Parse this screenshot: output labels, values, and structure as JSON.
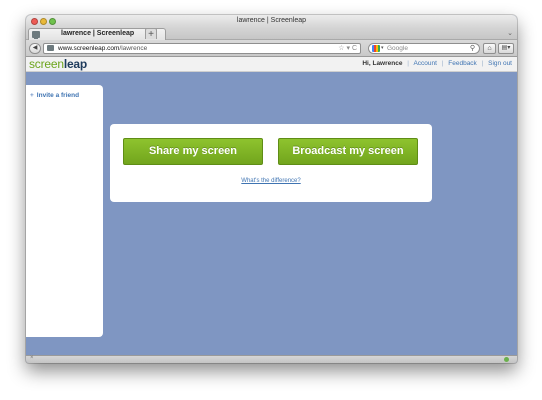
{
  "window": {
    "title": "lawrence | Screenleap"
  },
  "tabbar": {
    "tab_title": "lawrence | Screenleap",
    "close_glyph": "×",
    "new_tab_glyph": "+",
    "menu_glyph": "⌄"
  },
  "navbar": {
    "back_glyph": "◀",
    "url_host": "www.screenleap.com",
    "url_path": "/lawrence",
    "url_icons": "☆ ▾ C",
    "search_placeholder": "Google",
    "search_caret": "▾",
    "search_glyph": "⚲",
    "home_glyph": "⌂",
    "menu_glyph": "▤▾"
  },
  "header": {
    "logo_part1": "screen",
    "logo_part2": "leap",
    "greeting": "Hi, Lawrence",
    "separator": "|",
    "links": [
      "Account",
      "Feedback",
      "Sign out"
    ]
  },
  "sidebar": {
    "invite_plus": "+",
    "invite_label": "Invite a friend"
  },
  "card": {
    "share_label": "Share my screen",
    "broadcast_label": "Broadcast my screen",
    "difference_link": "What's the difference?"
  },
  "statusbar": {
    "close_glyph": "×"
  },
  "colors": {
    "background": "#7f96c2",
    "button_green": "#7fb226",
    "link_blue": "#3f74b2",
    "logo_green": "#6da51d",
    "logo_dark": "#1e3b5c"
  }
}
